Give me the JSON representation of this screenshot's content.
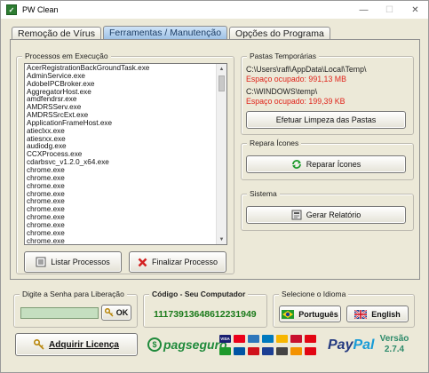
{
  "window": {
    "title": "PW Clean",
    "minimize_glyph": "—",
    "maximize_glyph": "☐",
    "close_glyph": "✕"
  },
  "tabs": [
    {
      "label": "Remoção de Vírus",
      "active": false
    },
    {
      "label": "Ferramentas / Manutenção",
      "active": true
    },
    {
      "label": "Opções do Programa",
      "active": false
    }
  ],
  "processes": {
    "group_title": "Processos em Execução",
    "items": [
      "AcerRegistrationBackGroundTask.exe",
      "AdminService.exe",
      "AdobeIPCBroker.exe",
      "AggregatorHost.exe",
      "amdfendrsr.exe",
      "AMDRSServ.exe",
      "AMDRSSrcExt.exe",
      "ApplicationFrameHost.exe",
      "atieclxx.exe",
      "atiesrxx.exe",
      "audiodg.exe",
      "CCXProcess.exe",
      "cdarbsvc_v1.2.0_x64.exe",
      "chrome.exe",
      "chrome.exe",
      "chrome.exe",
      "chrome.exe",
      "chrome.exe",
      "chrome.exe",
      "chrome.exe",
      "chrome.exe",
      "chrome.exe",
      "chrome.exe"
    ],
    "list_button": "Listar Processos",
    "end_button": "Finalizar Processo"
  },
  "temp_folders": {
    "group_title": "Pastas Temporárias",
    "path1": "C:\\Users\\rafl\\AppData\\Local\\Temp\\",
    "used1": "Espaço ocupado: 991,13 MB",
    "path2": "C:\\WINDOWS\\temp\\",
    "used2": "Espaço ocupado: 199,39 KB",
    "clean_button": "Efetuar Limpeza das Pastas"
  },
  "icons_repair": {
    "group_title": "Repara Ícones",
    "button": "Reparar Ícones"
  },
  "system": {
    "group_title": "Sistema",
    "button": "Gerar Relatório"
  },
  "password": {
    "group_title": "Digite a Senha para Liberação",
    "value": "",
    "ok_button": "OK"
  },
  "computer_code": {
    "title": "Código - Seu Computador",
    "value": "11173913648612231949"
  },
  "language": {
    "group_title": "Selecione o Idioma",
    "portuguese": "Português",
    "english": "English"
  },
  "buy_button": "Adquirir Licença",
  "payment": {
    "pagseguro": "pagseguro",
    "paypal_pay": "Pay",
    "paypal_pal": "Pal"
  },
  "version": {
    "label": "Versão",
    "number": "2.7.4"
  },
  "colors": {
    "accent_tab": "#9bbfe5",
    "used_text": "#e0241b",
    "code_text": "#1a7a1a",
    "background": "#ece9d8"
  }
}
